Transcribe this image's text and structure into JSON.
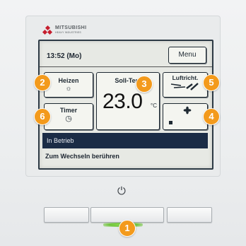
{
  "brand": {
    "name": "MITSUBISHI",
    "sub": "HEAVY INDUSTRIES"
  },
  "screen": {
    "time": "13:52 (Mo)",
    "menu_label": "Menu",
    "mode": {
      "label": "Heizen",
      "icon": "sun-icon"
    },
    "setpoint": {
      "label": "Soll-Tem",
      "value": "23.0",
      "unit": "°C"
    },
    "vane": {
      "label": "Luftricht."
    },
    "fan": {
      "icon": "fan-icon"
    },
    "timer": {
      "label": "Timer",
      "icon": "clock-icon"
    },
    "status": "In Betrieb",
    "hint": "Zum Wechseln berühren"
  },
  "badges": [
    "1",
    "2",
    "3",
    "4",
    "5",
    "6"
  ],
  "colors": {
    "badge": "#f39a1c",
    "status_bar": "#1b2c46",
    "led": "#7dd44a",
    "logo": "#c61e2e"
  }
}
